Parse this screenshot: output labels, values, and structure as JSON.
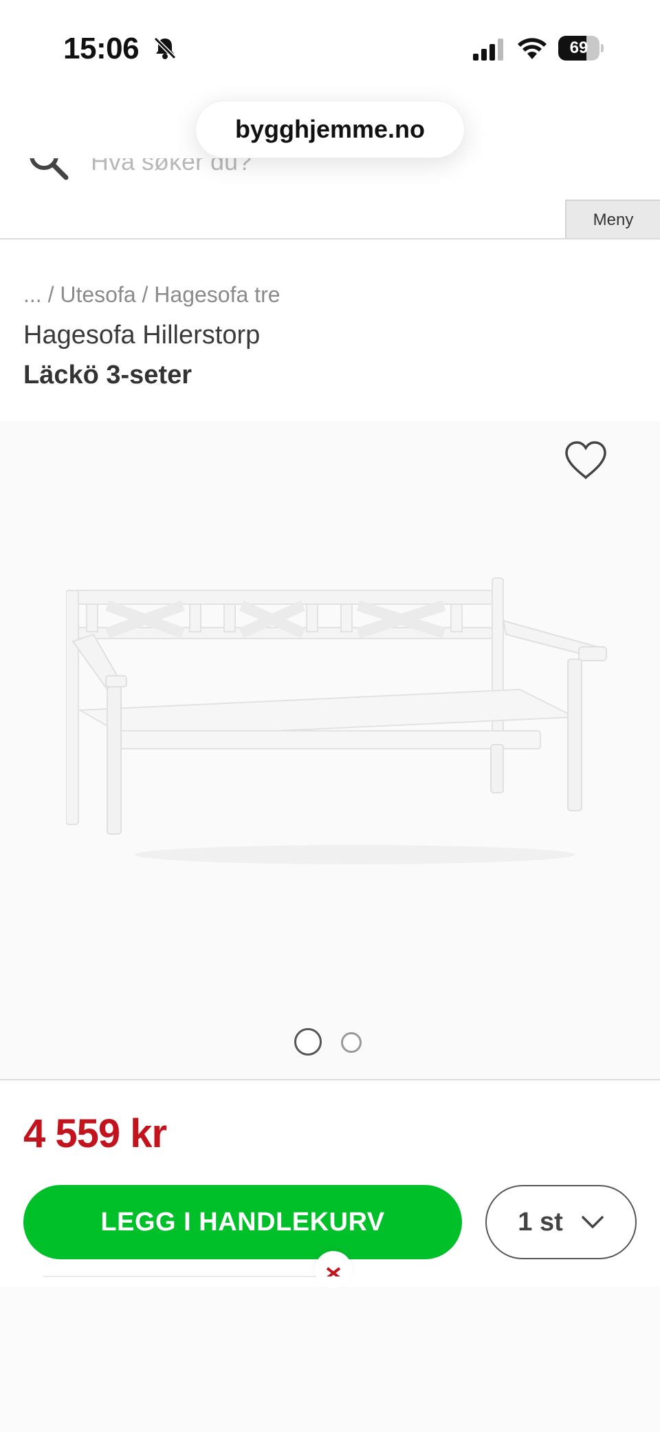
{
  "status_bar": {
    "time": "15:06",
    "battery_level": "69",
    "battery_fraction": 0.69
  },
  "browser": {
    "url": "bygghjemme.no"
  },
  "header": {
    "search_placeholder": "Hva søker du?",
    "menu_label": "Meny"
  },
  "breadcrumb": {
    "ellipsis": "...",
    "separator": "/",
    "items": [
      "Utesofa",
      "Hagesofa tre"
    ]
  },
  "product": {
    "brand_line": "Hagesofa Hillerstorp",
    "name": "Läckö 3-seter",
    "price": "4 559 kr",
    "image_count": 2,
    "active_image": 1
  },
  "purchase": {
    "cart_button_label": "LEGG I HANDLEKURV",
    "quantity": "1 st"
  },
  "colors": {
    "price_red": "#c3141d",
    "cart_green": "#00c02a",
    "close_red": "#c3141d"
  },
  "icons": [
    "bell-slash-icon",
    "signal-icon",
    "wifi-icon",
    "battery-icon",
    "search-icon",
    "heart-icon",
    "chevron-down-icon",
    "close-icon"
  ]
}
